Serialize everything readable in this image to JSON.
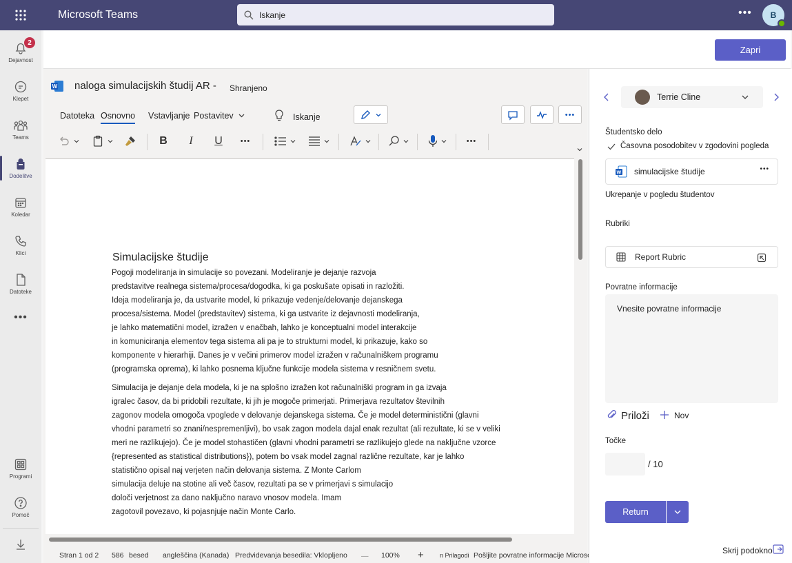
{
  "app": {
    "title": "Microsoft Teams"
  },
  "search": {
    "text": "Iskanje"
  },
  "user": {
    "initial": "B"
  },
  "rail": [
    {
      "label": "Dejavnost",
      "badge": "2"
    },
    {
      "label": "Klepet"
    },
    {
      "label": "Teams"
    },
    {
      "label": "Dodelitve"
    },
    {
      "label": "Koledar"
    },
    {
      "label": "Klici"
    },
    {
      "label": "Datoteke"
    },
    {
      "label": "Programi"
    },
    {
      "label": "Pomoč"
    }
  ],
  "header": {
    "close_label": "Zapri"
  },
  "word": {
    "doc_title": "naloga simulacijskih študij AR -",
    "saved": "Shranjeno",
    "menu": [
      "Datoteka",
      "Osnovno",
      "Vstavljanje",
      "Postavitev",
      "Iskanje"
    ],
    "heading": "Simulacijske študije",
    "para1": [
      "Pogoji modeliranja in simulacije so povezani. Modeliranje je dejanje razvoja",
      "predstavitve realnega sistema/procesa/dogodka, ki ga poskušate opisati in razložiti.",
      "Ideja modeliranja je, da ustvarite model, ki prikazuje vedenje/delovanje dejanskega",
      "procesa/sistema. Model (predstavitev) sistema, ki ga ustvarite iz dejavnosti modeliranja,",
      "je lahko matematični model, izražen v enačbah, lahko je konceptualni model interakcije",
      "in komuniciranja elementov tega sistema ali pa je to strukturni model, ki prikazuje, kako so",
      "komponente v hierarhiji. Danes je v večini primerov model izražen v računalniškem programu",
      "(programska oprema), ki lahko posnema ključne funkcije modela sistema v resničnem svetu."
    ],
    "para2": [
      "Simulacija je dejanje dela modela, ki je na splošno izražen kot računalniški program in ga izvaja",
      "igralec časov, da bi pridobili rezultate, ki jih je mogoče primerjati. Primerjava rezultatov številnih",
      "zagonov modela omogoča vpoglede v delovanje dejanskega sistema. Če je model deterministični (glavni",
      "vhodni parametri so znani/nespremenljivi), bo vsak zagon modela dajal enak rezultat (ali rezultate, ki se v veliki",
      "meri ne razlikujejo). Če je model stohastičen (glavni vhodni parametri se razlikujejo glede na naključne vzorce",
      "{represented as statistical distributions}), potem bo vsak model zagnal različne rezultate, kar je lahko",
      "statistično opisal naj verjeten način delovanja sistema. Z Monte Carlom",
      "simulacija deluje na stotine ali več časov, rezultati pa se v primerjavi s simulacijo",
      "določi verjetnost za dano naključno naravo vnosov modela. Imam",
      "zagotovil povezavo, ki pojasnjuje način Monte Carlo."
    ],
    "status": {
      "page": "Stran 1 od 2",
      "words_count": "586",
      "words_label": "besed",
      "language": "angleščina (Kanada)",
      "predictions": "Predvidevanja besedila: Vklopljeno",
      "zoom": "100%",
      "fit": "n Prilagodi",
      "feedback": "Pošljite povratne informacije Microsoftu"
    }
  },
  "panel": {
    "student_name": "Terrie Cline",
    "student_work_label": "Študentsko delo",
    "history_note": "Časovna posodobitev v zgodovini pogleda",
    "file_name": "simulacijske študije",
    "student_view_label": "Ukrepanje v pogledu študentov",
    "rubrics_label": "Rubriki",
    "rubric_name": "Report Rubric",
    "feedback_label": "Povratne informacije",
    "feedback_placeholder": "Vnesite povratne informacije",
    "attach_label": "Priloži",
    "new_label": "Nov",
    "points_label": "Točke",
    "points_total": "/ 10",
    "return_label": "Return",
    "hide_pane": "Skrij podokno"
  },
  "colors": {
    "brand": "#464775",
    "accent": "#5b5fc7",
    "word_blue": "#185abd",
    "badge": "#c4314b"
  }
}
